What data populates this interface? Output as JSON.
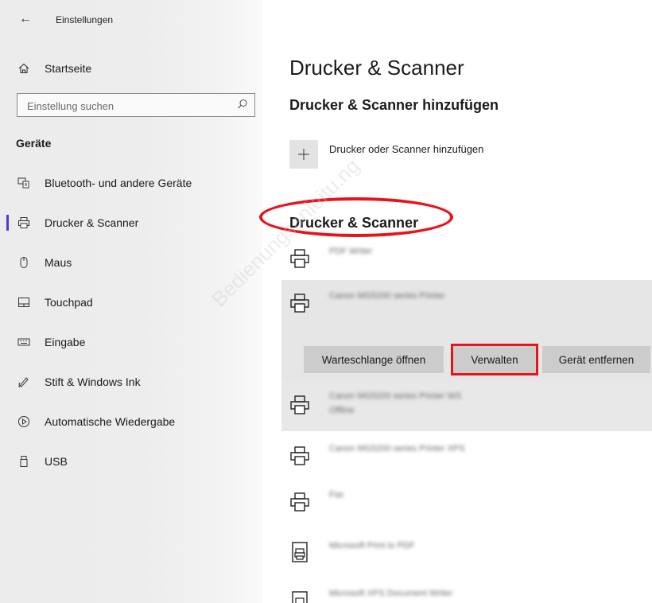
{
  "window": {
    "title": "Einstellungen"
  },
  "sidebar": {
    "home_label": "Startseite",
    "search": {
      "placeholder": "Einstellung suchen"
    },
    "section_heading": "Geräte",
    "items": [
      {
        "label": "Bluetooth- und andere Geräte",
        "icon": "bluetooth-devices-icon",
        "active": false
      },
      {
        "label": "Drucker & Scanner",
        "icon": "printer-icon",
        "active": true
      },
      {
        "label": "Maus",
        "icon": "mouse-icon",
        "active": false
      },
      {
        "label": "Touchpad",
        "icon": "touchpad-icon",
        "active": false
      },
      {
        "label": "Eingabe",
        "icon": "keyboard-icon",
        "active": false
      },
      {
        "label": "Stift & Windows Ink",
        "icon": "pen-icon",
        "active": false
      },
      {
        "label": "Automatische Wiedergabe",
        "icon": "autoplay-icon",
        "active": false
      },
      {
        "label": "USB",
        "icon": "usb-icon",
        "active": false
      }
    ]
  },
  "main": {
    "page_title": "Drucker & Scanner",
    "add_section": {
      "heading": "Drucker & Scanner hinzufügen",
      "add_label": "Drucker oder Scanner hinzufügen"
    },
    "list_heading": "Drucker & Scanner",
    "printers": [
      {
        "name": "PDF Writer",
        "sub": ""
      },
      {
        "name": "Canon MG5200 series Printer",
        "sub": ""
      },
      {
        "name": "Canon MG5200 series Printer WS",
        "sub": "Offline"
      },
      {
        "name": "Canon MG5200 series Printer XPS",
        "sub": ""
      },
      {
        "name": "Fax",
        "sub": ""
      },
      {
        "name": "Microsoft Print to PDF",
        "sub": ""
      },
      {
        "name": "Microsoft XPS Document Writer",
        "sub": ""
      }
    ],
    "actions": {
      "queue": "Warteschlange öffnen",
      "manage": "Verwalten",
      "remove": "Gerät entfernen"
    }
  },
  "watermark": "Bedienungsanleitu.ng",
  "colors": {
    "accent": "#4b3bd4",
    "highlight": "#e8141c",
    "selected_row": "#e6e6e6",
    "button": "#cccccc"
  }
}
